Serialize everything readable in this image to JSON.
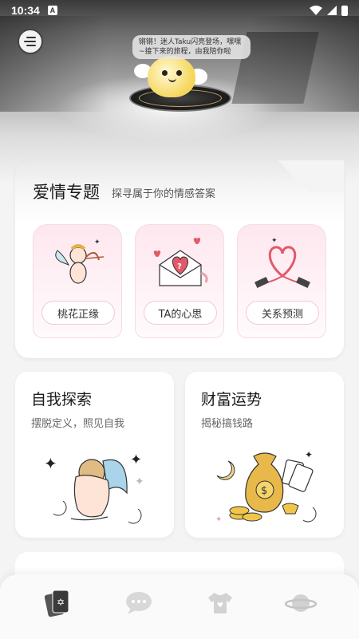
{
  "status_bar": {
    "time": "10:34",
    "notification_icon": "A"
  },
  "header": {
    "menu_icon": "menu-icon",
    "speech_bubble": "锵锵！迷人Taku闪亮登场，嘿嘿~接下来的旅程，由我陪你啦"
  },
  "love_section": {
    "title": "爱情专题",
    "subtitle": "探寻属于你的情感答案",
    "items": [
      {
        "label": "桃花正缘",
        "icon": "cupid-icon"
      },
      {
        "label": "TA的心思",
        "icon": "love-letter-icon"
      },
      {
        "label": "关系预测",
        "icon": "heart-cable-icon"
      }
    ]
  },
  "explore_card": {
    "title": "自我探索",
    "subtitle": "摆脱定义，照见自我",
    "icon": "angel-figure-icon"
  },
  "wealth_card": {
    "title": "财富运势",
    "subtitle": "揭秘搞钱路",
    "icon": "money-bag-icon"
  },
  "bottom_nav": [
    {
      "name": "tarot-cards-icon",
      "active": true
    },
    {
      "name": "chat-icon",
      "active": false
    },
    {
      "name": "shirt-icon",
      "active": false
    },
    {
      "name": "planet-icon",
      "active": false
    }
  ],
  "colors": {
    "accent_pink": "#f1c9d5",
    "background": "#f4f4f4"
  }
}
